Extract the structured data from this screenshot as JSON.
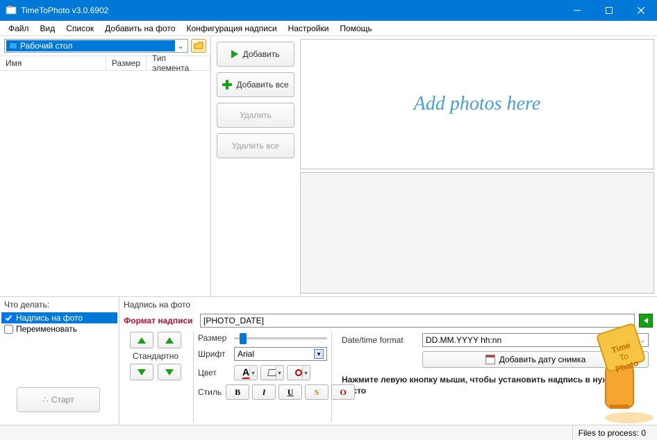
{
  "window": {
    "title": "TimeToPhoto v3.0.6902"
  },
  "menu": {
    "file": "Файл",
    "view": "Вид",
    "list": "Список",
    "add": "Добавить на фото",
    "conf": "Конфигурация надписи",
    "set": "Настройки",
    "help": "Помощь"
  },
  "folder": {
    "selected": "Рабочий стол"
  },
  "columns": {
    "name": "Имя",
    "size": "Размер",
    "type": "Тип элемента"
  },
  "buttons": {
    "add": "Добавить",
    "add_all": "Добавить все",
    "remove": "Удалить",
    "remove_all": "Удалить все"
  },
  "preview": {
    "placeholder": "Add photos here"
  },
  "what": {
    "group": "Что делать:",
    "caption": "Надпись на фото",
    "rename": "Переименовать",
    "start": "Старт"
  },
  "caption_panel": {
    "group": "Надпись на фото",
    "fmt_label": "Формат надписи",
    "fmt_value": "[PHOTO_DATE]",
    "size": "Размер",
    "font": "Шрифт",
    "font_value": "Arial",
    "color": "Цвет",
    "style": "Стиль",
    "standard": "Стандартно",
    "date_label": "Date/time format",
    "date_value": "DD.MM.YYYY hh:nn",
    "add_date": "Добавить дату снимка",
    "hint": "Нажмите левую кнопку мыши, чтобы установить надпись в нужное место",
    "style_b": "B",
    "style_i": "I",
    "style_u": "U",
    "style_s": "S",
    "style_o": "O"
  },
  "status": {
    "files": "Files to process: 0"
  }
}
